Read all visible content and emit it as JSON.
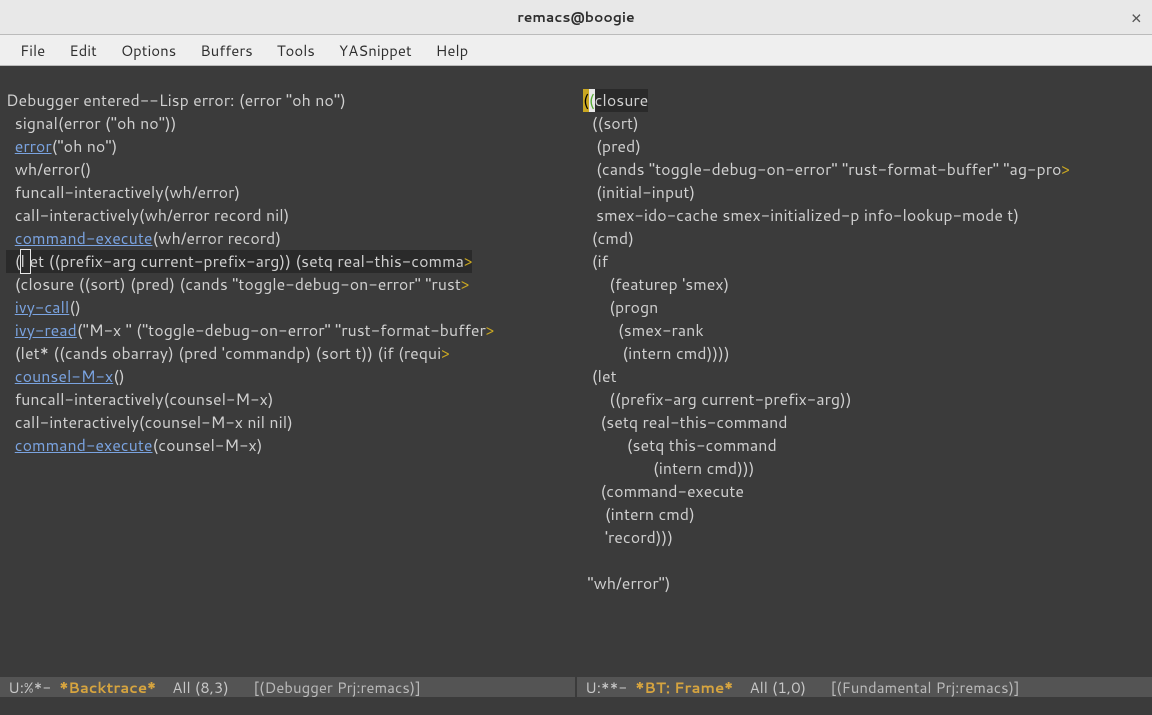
{
  "window": {
    "title": "remacs@boogie",
    "close_glyph": "×"
  },
  "menu": {
    "items": [
      "File",
      "Edit",
      "Options",
      "Buffers",
      "Tools",
      "YASnippet",
      "Help"
    ]
  },
  "left": {
    "l01": "Debugger entered--Lisp error: (error \"oh no\")",
    "l02": "  signal(error (\"oh no\"))",
    "l03a": "  ",
    "l03link": "error",
    "l03b": "(\"oh no\")",
    "l04": "  wh/error()",
    "l05": "  funcall-interactively(wh/error)",
    "l06": "  call-interactively(wh/error record nil)",
    "l07a": "  ",
    "l07link": "command-execute",
    "l07b": "(wh/error record)",
    "l08a": "  (",
    "l08cur": "l",
    "l08b": "et ((prefix-arg current-prefix-arg)) (setq real-this-comma",
    "l08arrow": ">",
    "l09a": "  (closure ((sort) (pred) (cands \"toggle-debug-on-error\" \"rust",
    "l09arrow": ">",
    "l10a": "  ",
    "l10link": "ivy-call",
    "l10b": "()",
    "l11a": "  ",
    "l11link": "ivy-read",
    "l11b": "(\"M-x \" (\"toggle-debug-on-error\" \"rust-format-buffer",
    "l11arrow": ">",
    "l12a": "  (let* ((cands obarray) (pred 'commandp) (sort t)) (if (requi",
    "l12arrow": ">",
    "l13a": "  ",
    "l13link": "counsel-M-x",
    "l13b": "()",
    "l14": "  funcall-interactively(counsel-M-x)",
    "l15": "  call-interactively(counsel-M-x nil nil)",
    "l16a": "  ",
    "l16link": "command-execute",
    "l16b": "(counsel-M-x)",
    "modeline": {
      "status": " U:%*-  ",
      "buffer": "*Backtrace*",
      "percent": "    All ",
      "pos": "(8,3)",
      "mode": "      [(Debugger Prj:remacs)]"
    }
  },
  "right": {
    "l01open": "(",
    "l01cur": "(",
    "l01rest": "closure",
    "l02": "  ((sort)",
    "l03": "   (pred)",
    "l04": "   (cands \"toggle-debug-on-error\" \"rust-format-buffer\" \"ag-pro",
    "l04arrow": ">",
    "l05": "   (initial-input)",
    "l06": "   smex-ido-cache smex-initialized-p info-lookup-mode t)",
    "l07": "  (cmd)",
    "l08": "  (if",
    "l09": "      (featurep 'smex)",
    "l10": "      (progn",
    "l11": "        (smex-rank",
    "l12": "         (intern cmd))))",
    "l13": "  (let",
    "l14": "      ((prefix-arg current-prefix-arg))",
    "l15": "    (setq real-this-command",
    "l16": "          (setq this-command",
    "l17": "                (intern cmd)))",
    "l18": "    (command-execute",
    "l19": "     (intern cmd)",
    "l20": "     'record)))",
    "l21": "",
    "l22": " \"wh/error\")",
    "modeline": {
      "status": " U:**-  ",
      "buffer": "*BT: Frame*",
      "percent": "    All ",
      "pos": "(1,0)",
      "mode": "      [(Fundamental Prj:remacs)]"
    }
  }
}
